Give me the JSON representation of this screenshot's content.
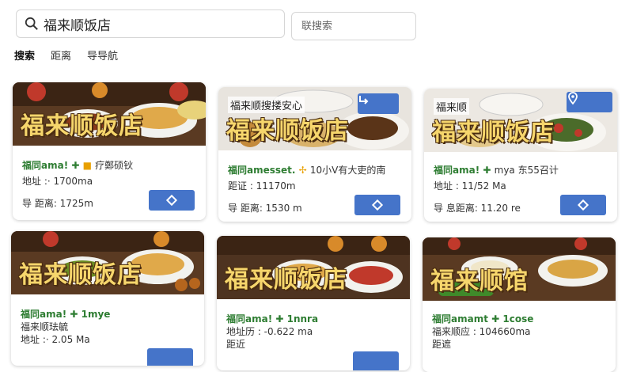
{
  "search": {
    "query": "福来顺饭店",
    "secondary_placeholder": "联搜索"
  },
  "tabs": [
    {
      "label": "搜索",
      "active": true
    },
    {
      "label": "距离",
      "active": false
    },
    {
      "label": "导导航",
      "active": false
    }
  ],
  "cards": [
    {
      "title": "福来顺饭店",
      "overlay": "",
      "line1": "福同ama!",
      "line1b": "疗鄭硕钬",
      "line2": "地址 :· 1700ma",
      "line3": "导 距离: 1725m"
    },
    {
      "title": "福来顺饭店",
      "overlay": "福来顺搜搂安心",
      "line1": "福同amesset.",
      "line1b": "10小V有大吏的南",
      "line2": "距证 : 11170m",
      "line3": "导 距离: 1530 m"
    },
    {
      "title": "福来顺饭店",
      "overlay": "福来顺",
      "line1": "福同ama!",
      "line1b": "mya  东55召计",
      "line2": "地址 : 11/52 Ma",
      "line3": "导 息距离: 11.20 re"
    },
    {
      "title": "福来顺饭店",
      "overlay": "",
      "line1": "福同ama!",
      "line1b": "1mye",
      "line2": "福来顺珐毓",
      "line3": "地址 :· 2.05 Ma"
    },
    {
      "title": "福来顺饭店",
      "overlay": "",
      "line1": "福同ama!",
      "line1b": "1nnra",
      "line2": "地址历 : -0.622 ma",
      "line3": "距近"
    },
    {
      "title": "福来顺馆",
      "overlay": "",
      "line1": "福同amamt",
      "line1b": "1cose",
      "line2": "福来顺应 : 104660ma",
      "line3": "距遮"
    }
  ],
  "colors": {
    "accent": "#4574c9",
    "rating_green": "#2e7d32",
    "badge_orange": "#e8a000",
    "title_gold": "#f6d66c"
  }
}
